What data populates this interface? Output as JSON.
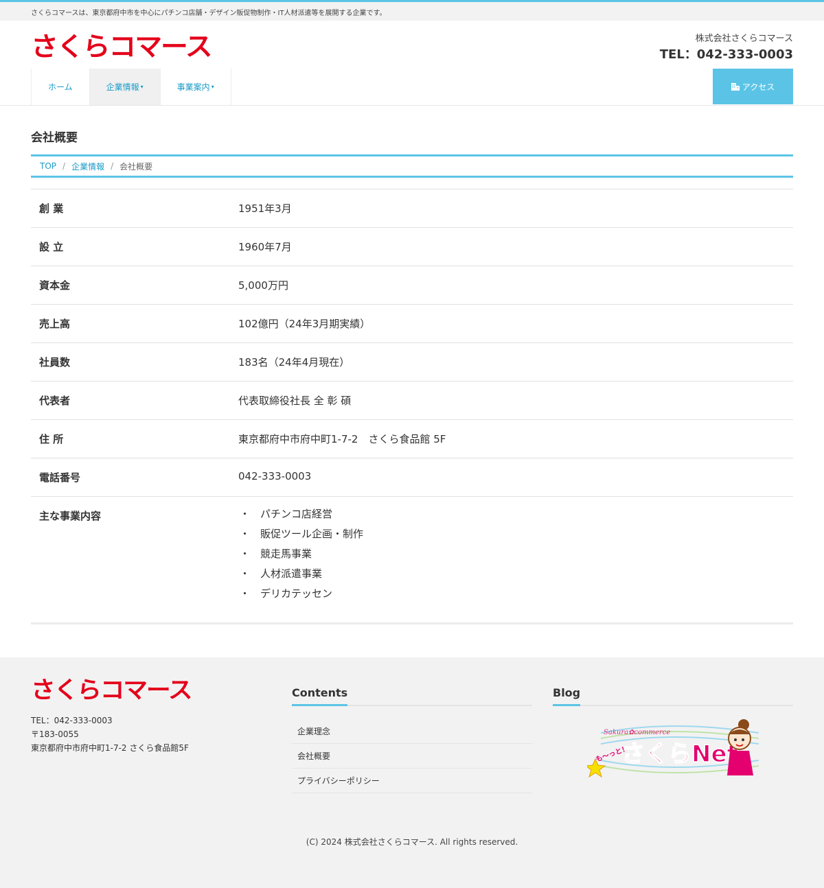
{
  "topbar": {
    "tagline": "さくらコマースは、東京都府中市を中心にパチンコ店舗・デザイン販促物制作・IT人材派遣等を展開する企業です。"
  },
  "header": {
    "logo_text": "さくらコマース",
    "company": "株式会社さくらコマース",
    "tel": "TEL：042-333-0003"
  },
  "nav": {
    "items": [
      {
        "label": "ホーム"
      },
      {
        "label": "企業情報"
      },
      {
        "label": "事業案内"
      }
    ],
    "access_label": "アクセス"
  },
  "page": {
    "title": "会社概要",
    "breadcrumb": [
      "TOP",
      "企業情報",
      "会社概要"
    ]
  },
  "table": {
    "rows": [
      {
        "label": "創 業",
        "value": "1951年3月"
      },
      {
        "label": "設 立",
        "value": "1960年7月"
      },
      {
        "label": "資本金",
        "value": "5,000万円"
      },
      {
        "label": "売上高",
        "value": "102億円（24年3月期実績）"
      },
      {
        "label": "社員数",
        "value": "183名（24年4月現在）"
      },
      {
        "label": "代表者",
        "value": "代表取締役社長 全 彰 碩"
      },
      {
        "label": "住 所",
        "value": "東京都府中市府中町1-7-2　さくら食品館 5F"
      },
      {
        "label": "電話番号",
        "value": "042-333-0003"
      }
    ],
    "business_label": "主な事業内容",
    "business_items": [
      "パチンコ店経営",
      "販促ツール企画・制作",
      "競走馬事業",
      "人材派遣事業",
      "デリカテッセン"
    ]
  },
  "footer": {
    "logo_text": "さくらコマース",
    "tel": "TEL：042-333-0003",
    "postal": "〒183-0055",
    "address": "東京都府中市府中町1-7-2 さくら食品館5F",
    "contents_title": "Contents",
    "links": [
      "企業理念",
      "会社概要",
      "プライバシーポリシー"
    ],
    "blog_title": "Blog",
    "blog_banner": {
      "brand": "Sakura✿commerce",
      "tagline": "も〜っと！",
      "name": "さくらNet"
    },
    "copyright": "(C) 2024 株式会社さくらコマース. All rights reserved."
  },
  "colors": {
    "accent": "#5bc4e6",
    "brand_red": "#e4001a",
    "link": "#1a9bc7"
  }
}
